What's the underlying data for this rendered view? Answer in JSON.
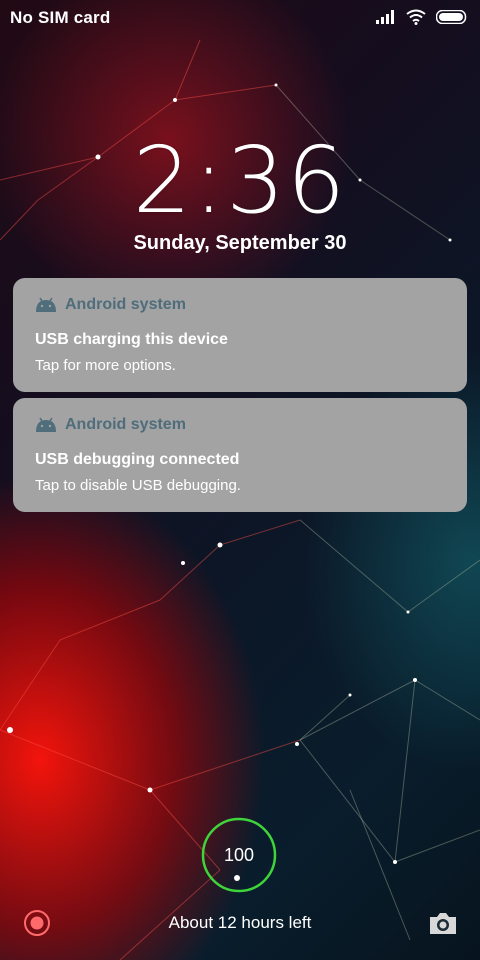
{
  "status_bar": {
    "carrier": "No SIM card",
    "icons": [
      "signal-icon",
      "wifi-icon",
      "battery-icon"
    ]
  },
  "lockscreen": {
    "time": "2:36",
    "date": "Sunday, September 30"
  },
  "notifications": [
    {
      "app": "Android system",
      "title": "USB charging this device",
      "body": "Tap for more options."
    },
    {
      "app": "Android system",
      "title": "USB debugging connected",
      "body": "Tap to disable USB debugging."
    }
  ],
  "battery": {
    "level": "100",
    "time_left": "About 12 hours left",
    "ring_color": "#3fd43a"
  },
  "shortcuts": {
    "left": "record-icon",
    "right": "camera-icon"
  },
  "colors": {
    "notification_bg": "#a3a3a3",
    "app_name": "#4f6d7a"
  }
}
